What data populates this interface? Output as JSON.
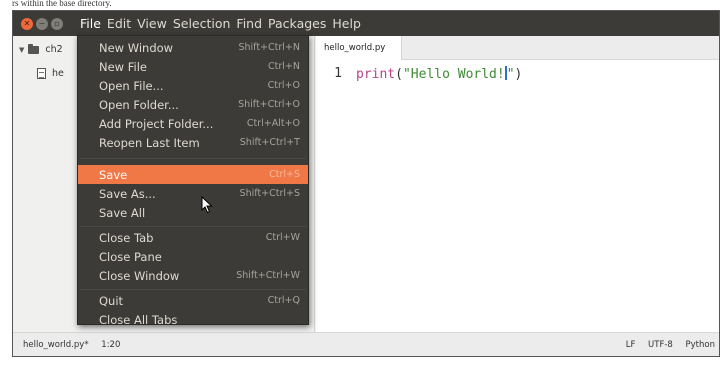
{
  "background_doc": {
    "snippet": "rs within the base directory."
  },
  "window": {
    "controls": {
      "close_icon": "close-icon",
      "minimize_icon": "minimize-icon",
      "maximize_icon": "maximize-icon"
    },
    "menubar": [
      "File",
      "Edit",
      "View",
      "Selection",
      "Find",
      "Packages",
      "Help"
    ]
  },
  "tree": {
    "folder": "ch2",
    "file_partial": "he"
  },
  "tab": {
    "name": "hello_world.py"
  },
  "editor": {
    "line_number": "1",
    "code_fn": "print",
    "code_open": "(",
    "code_string_before_cursor": "\"Hello World!",
    "code_string_after_cursor": "\"",
    "code_close": ")"
  },
  "status": {
    "file": "hello_world.py*",
    "position": "1:20",
    "line_ending": "LF",
    "encoding": "UTF-8",
    "grammar": "Python"
  },
  "file_menu": {
    "items": [
      {
        "label": "New Window",
        "shortcut": "Shift+Ctrl+N"
      },
      {
        "label": "New File",
        "shortcut": "Ctrl+N"
      },
      {
        "label": "Open File...",
        "shortcut": "Ctrl+O"
      },
      {
        "label": "Open Folder...",
        "shortcut": "Shift+Ctrl+O"
      },
      {
        "label": "Add Project Folder...",
        "shortcut": "Ctrl+Alt+O"
      },
      {
        "label": "Reopen Last Item",
        "shortcut": "Shift+Ctrl+T"
      },
      {
        "label": "Save",
        "shortcut": "Ctrl+S",
        "highlighted": true
      },
      {
        "label": "Save As...",
        "shortcut": "Shift+Ctrl+S"
      },
      {
        "label": "Save All",
        "shortcut": ""
      },
      {
        "label": "Close Tab",
        "shortcut": "Ctrl+W"
      },
      {
        "label": "Close Pane",
        "shortcut": ""
      },
      {
        "label": "Close Window",
        "shortcut": "Shift+Ctrl+W"
      },
      {
        "label": "Quit",
        "shortcut": "Ctrl+Q"
      },
      {
        "label": "Close All Tabs",
        "shortcut": ""
      }
    ]
  },
  "colors": {
    "menu_bg": "#3c3b37",
    "highlight": "#f07746",
    "close_button": "#f0683a",
    "string": "#3e8a36",
    "function": "#b5478b",
    "cursor": "#2b6fd6"
  }
}
